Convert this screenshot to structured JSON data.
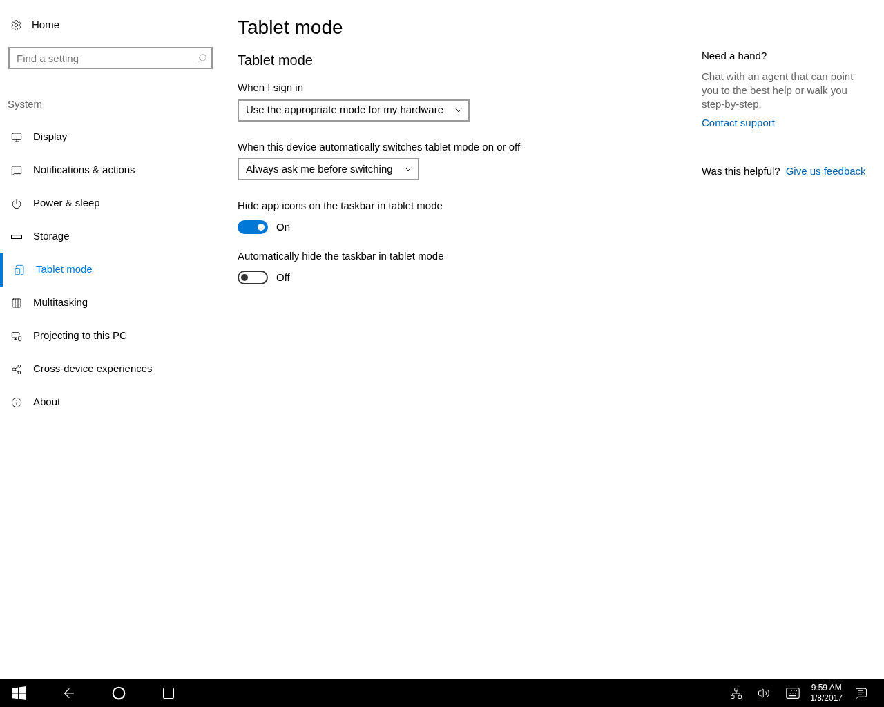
{
  "sidebar": {
    "home": "Home",
    "search": {
      "placeholder": "Find a setting"
    },
    "section": "System",
    "items": [
      {
        "label": "Display",
        "selected": false
      },
      {
        "label": "Notifications & actions",
        "selected": false
      },
      {
        "label": "Power & sleep",
        "selected": false
      },
      {
        "label": "Storage",
        "selected": false
      },
      {
        "label": "Tablet mode",
        "selected": true
      },
      {
        "label": "Multitasking",
        "selected": false
      },
      {
        "label": "Projecting to this PC",
        "selected": false
      },
      {
        "label": "Cross-device experiences",
        "selected": false
      },
      {
        "label": "About",
        "selected": false
      }
    ]
  },
  "main": {
    "title": "Tablet mode",
    "subtitle": "Tablet mode",
    "settings": [
      {
        "kind": "dropdown",
        "label": "When I sign in",
        "value": "Use the appropriate mode for my hardware"
      },
      {
        "kind": "dropdown",
        "label": "When this device automatically switches tablet mode on or off",
        "value": "Always ask me before switching"
      },
      {
        "kind": "toggle",
        "label": "Hide app icons on the taskbar in tablet mode",
        "on": true,
        "state": "On"
      },
      {
        "kind": "toggle",
        "label": "Automatically hide the taskbar in tablet mode",
        "on": false,
        "state": "Off"
      }
    ]
  },
  "help": {
    "title": "Need a hand?",
    "text": "Chat with an agent that can point you to the best help or walk you step-by-step.",
    "link": "Contact support",
    "question": "Was this helpful?",
    "feedback": "Give us feedback"
  },
  "taskbar": {
    "time": "9:59 AM",
    "date": "1/8/2017"
  }
}
